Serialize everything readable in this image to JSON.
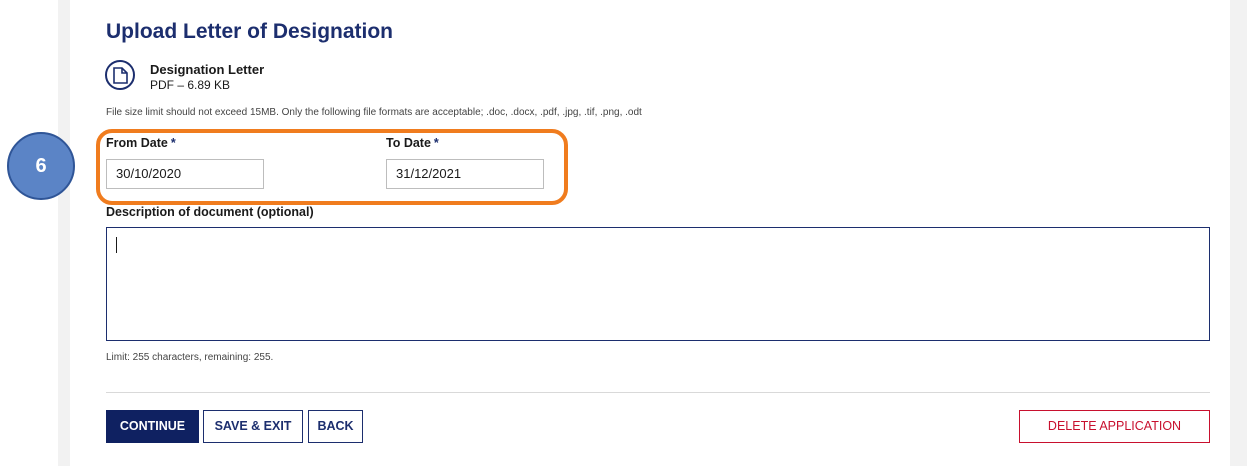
{
  "upload": {
    "title": "Upload Letter of Designation",
    "document": {
      "name": "Designation Letter",
      "meta": "PDF – 6.89 KB",
      "icon": "document-icon"
    },
    "hint": "File size limit should not exceed 15MB. Only the following file formats are acceptable; .doc, .docx, .pdf, .jpg, .tif, .png, .odt"
  },
  "dates": {
    "from_label": "From Date",
    "from_value": "30/10/2020",
    "to_label": "To Date",
    "to_value": "31/12/2021",
    "required_mark": "*"
  },
  "description": {
    "label": "Description of document (optional)",
    "value": "",
    "limit_text": "Limit: 255 characters, remaining: 255."
  },
  "annotation": {
    "step": "6",
    "highlight_color": "#f07c1e",
    "badge_color": "#5b84c6"
  },
  "actions": {
    "continue": "CONTINUE",
    "save_exit": "SAVE & EXIT",
    "back": "BACK",
    "delete": "DELETE APPLICATION"
  },
  "colors": {
    "brand": "#1c2e6e",
    "danger": "#c8102e"
  }
}
